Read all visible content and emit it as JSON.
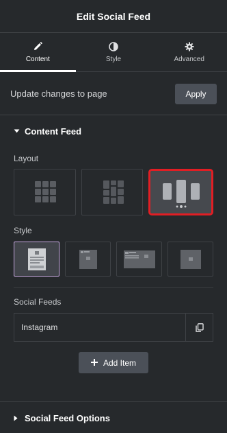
{
  "header": {
    "title": "Edit Social Feed"
  },
  "tabs": [
    {
      "label": "Content",
      "icon": "pencil-icon",
      "active": true
    },
    {
      "label": "Style",
      "icon": "half-circle-icon",
      "active": false
    },
    {
      "label": "Advanced",
      "icon": "gear-icon",
      "active": false
    }
  ],
  "update": {
    "label": "Update changes to page",
    "apply_label": "Apply"
  },
  "content_feed": {
    "title": "Content Feed",
    "layout_label": "Layout",
    "layouts": [
      "grid-layout",
      "masonry-layout",
      "carousel-layout"
    ],
    "selected_layout": "carousel-layout",
    "style_label": "Style",
    "styles": [
      "style-1",
      "style-2",
      "style-3",
      "style-4"
    ],
    "selected_style": "style-1",
    "feeds_label": "Social Feeds",
    "feeds": [
      "Instagram"
    ],
    "add_item_label": "Add Item"
  },
  "social_feed_options": {
    "title": "Social Feed Options"
  },
  "colors": {
    "accent_red": "#e11e24",
    "selected_style_border": "#c7a8e0",
    "panel_bg": "#26292c"
  }
}
